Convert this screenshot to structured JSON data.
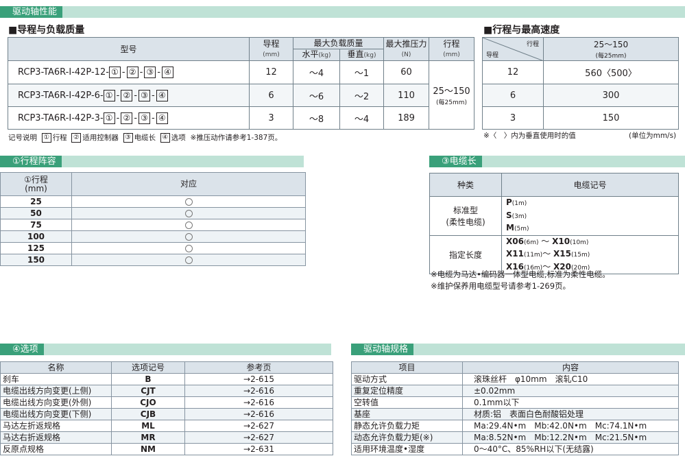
{
  "header": {
    "title": "驱动轴性能"
  },
  "load_table": {
    "title": "■导程与负载质量",
    "headers": {
      "model": "型号",
      "lead": "导程",
      "lead_unit": "(mm)",
      "max_load": "最大负载质量",
      "horizontal": "水平",
      "horizontal_unit": "(kg)",
      "vertical": "垂直",
      "vertical_unit": "(kg)",
      "max_push": "最大推压力",
      "max_push_unit": "(N)",
      "stroke": "行程",
      "stroke_unit": "(mm)"
    },
    "rows": [
      {
        "model": "RCP3-TA6R-I-42P-12-",
        "lead": "12",
        "horizontal": "～4",
        "vertical": "～1",
        "push": "60"
      },
      {
        "model": "RCP3-TA6R-I-42P-6-",
        "lead": "6",
        "horizontal": "～6",
        "vertical": "～2",
        "push": "110"
      },
      {
        "model": "RCP3-TA6R-I-42P-3-",
        "lead": "3",
        "horizontal": "～8",
        "vertical": "～4",
        "push": "189"
      }
    ],
    "box_labels": [
      "①",
      "②",
      "③",
      "④"
    ],
    "stroke_value": "25～150",
    "stroke_note": "(每25mm)"
  },
  "legend": {
    "prefix": "记号说明",
    "items": [
      {
        "num": "①",
        "text": "行程"
      },
      {
        "num": "②",
        "text": "适用控制器"
      },
      {
        "num": "③",
        "text": "电缆长"
      },
      {
        "num": "④",
        "text": "选项"
      }
    ],
    "note": "※推压动作请参考1-387页。"
  },
  "speed_table": {
    "title": "■行程与最高速度",
    "corner_stroke": "行程",
    "corner_lead": "导程",
    "stroke_range": "25～150",
    "stroke_note": "(每25mm)",
    "rows": [
      {
        "lead": "12",
        "speed": "560〈500〉"
      },
      {
        "lead": "6",
        "speed": "300"
      },
      {
        "lead": "3",
        "speed": "150"
      }
    ],
    "note_left": "※〈　〉内为垂直使用时的值",
    "note_right": "(单位为mm/s)"
  },
  "stroke_section": {
    "title": "①行程阵容",
    "header_stroke": "①行程",
    "header_unit": "(mm)",
    "header_support": "对应",
    "rows": [
      "25",
      "50",
      "75",
      "100",
      "125",
      "150"
    ]
  },
  "cable_section": {
    "title": "③电缆长",
    "header_type": "种类",
    "header_code": "电缆记号",
    "standard_label_1": "标准型",
    "standard_label_2": "(柔性电缆)",
    "standard_codes": [
      {
        "code": "P",
        "len": "(1m)"
      },
      {
        "code": "S",
        "len": "(3m)"
      },
      {
        "code": "M",
        "len": "(5m)"
      }
    ],
    "custom_label": "指定长度",
    "custom_codes": [
      {
        "a": "X06",
        "a_len": "(6m)",
        "sep": "～",
        "b": "X10",
        "b_len": "(10m)"
      },
      {
        "a": "X11",
        "a_len": "(11m)",
        "sep": "～",
        "b": "X15",
        "b_len": "(15m)"
      },
      {
        "a": "X16",
        "a_len": "(16m)",
        "sep": "～",
        "b": "X20",
        "b_len": "(20m)"
      }
    ],
    "note1": "※电缆为马达•编码器一体型电缆,标准为柔性电缆。",
    "note2": "※维护保养用电缆型号请参考1-269页。"
  },
  "options_section": {
    "title": "④选项",
    "headers": [
      "名称",
      "选项记号",
      "参考页"
    ],
    "rows": [
      {
        "name": "刹车",
        "code": "B",
        "page": "→2-615"
      },
      {
        "name": "电缆出线方向变更(上侧)",
        "code": "CJT",
        "page": "→2-616"
      },
      {
        "name": "电缆出线方向变更(外侧)",
        "code": "CJO",
        "page": "→2-616"
      },
      {
        "name": "电缆出线方向变更(下侧)",
        "code": "CJB",
        "page": "→2-616"
      },
      {
        "name": "马达左折返规格",
        "code": "ML",
        "page": "→2-627"
      },
      {
        "name": "马达右折返规格",
        "code": "MR",
        "page": "→2-627"
      },
      {
        "name": "反原点规格",
        "code": "NM",
        "page": "→2-631"
      }
    ]
  },
  "spec_section": {
    "title": "驱动轴规格",
    "headers": [
      "项目",
      "内容"
    ],
    "rows": [
      {
        "item": "驱动方式",
        "value": "滚珠丝杆　φ10mm　滚轧C10"
      },
      {
        "item": "重复定位精度",
        "value": "±0.02mm"
      },
      {
        "item": "空转值",
        "value": "0.1mm以下"
      },
      {
        "item": "基座",
        "value": "材质:铝　表面白色耐酸铝处理"
      },
      {
        "item": "静态允许负载力矩",
        "value": "Ma:29.4N•m　Mb:42.0N•m　Mc:74.1N•m"
      },
      {
        "item": "动态允许负载力矩(※)",
        "value": "Ma:8.52N•m　Mb:12.2N•m　Mc:21.5N•m"
      },
      {
        "item": "适用环境温度•湿度",
        "value": "0～40°C、85%RH以下(无结露)"
      }
    ]
  }
}
